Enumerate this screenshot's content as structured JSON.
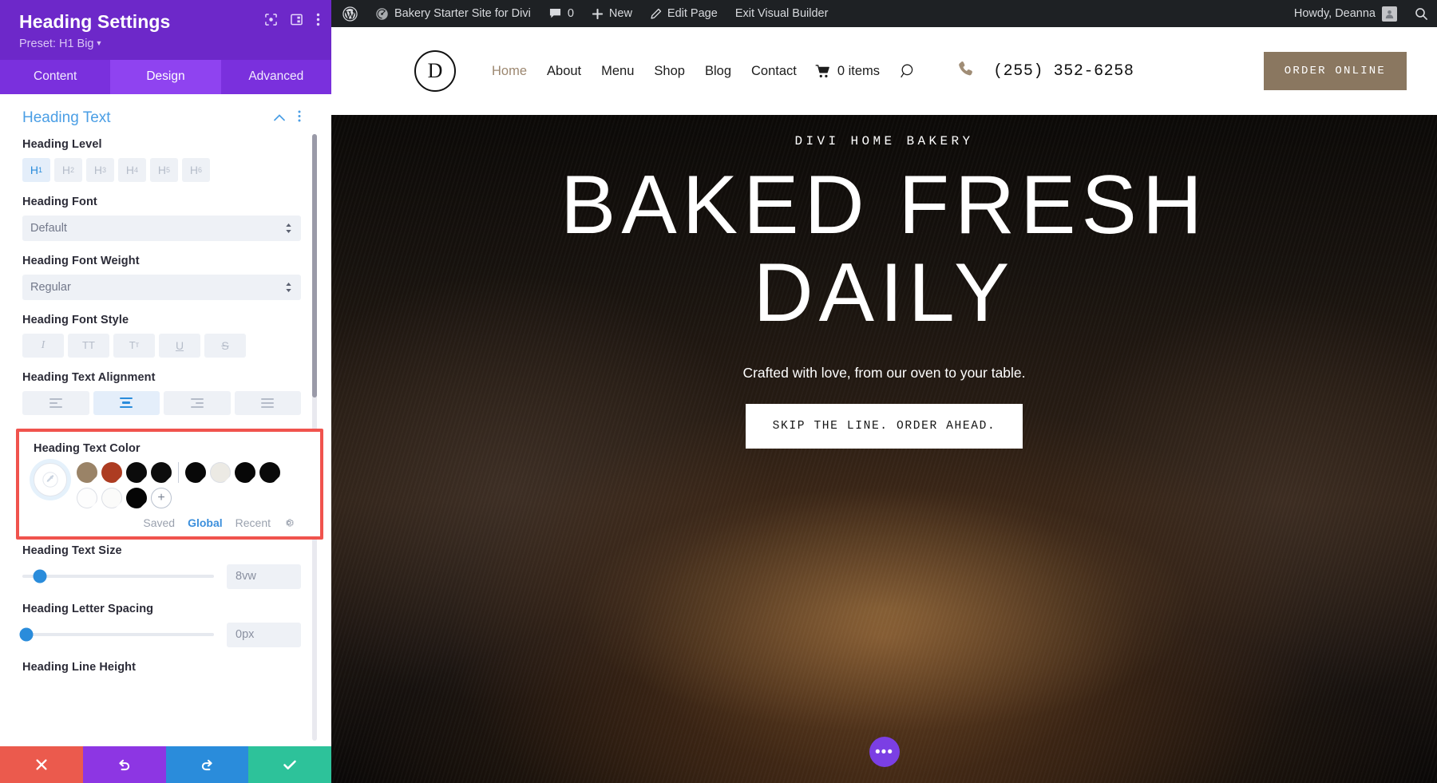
{
  "settings_panel": {
    "title": "Heading Settings",
    "preset_label": "Preset: H1 Big",
    "header_icons": [
      {
        "name": "focus-target-icon"
      },
      {
        "name": "layout-columns-icon"
      },
      {
        "name": "kebab-menu-icon"
      }
    ],
    "tabs": [
      {
        "label": "Content",
        "active": false
      },
      {
        "label": "Design",
        "active": true
      },
      {
        "label": "Advanced",
        "active": false
      }
    ],
    "section": {
      "title": "Heading Text",
      "collapse_icon": "chevron-up-icon",
      "menu_icon": "kebab-menu-icon"
    },
    "heading_level": {
      "label": "Heading Level",
      "options": [
        "H1",
        "H2",
        "H3",
        "H4",
        "H5",
        "H6"
      ],
      "selected": "H1"
    },
    "heading_font": {
      "label": "Heading Font",
      "value": "Default"
    },
    "heading_font_weight": {
      "label": "Heading Font Weight",
      "value": "Regular"
    },
    "heading_font_style": {
      "label": "Heading Font Style",
      "options": [
        "I",
        "TT",
        "Tт",
        "U",
        "S"
      ],
      "selected": null
    },
    "heading_text_alignment": {
      "label": "Heading Text Alignment",
      "options": [
        "left",
        "center",
        "right",
        "justify"
      ],
      "selected": "center"
    },
    "heading_text_color": {
      "label": "Heading Text Color",
      "eyedropper_icon": "eyedropper-icon",
      "swatches_row1": [
        "#9a8367",
        "#ad3c22",
        "#0b0b0b",
        "#0d0d0d",
        "#080808",
        "#eceae4",
        "#070707",
        "#0a0a0a"
      ],
      "swatches_row2": [
        "#fdfdfd",
        "#fbfbfa",
        "#050505"
      ],
      "add_label": "+",
      "tabs": [
        {
          "label": "Saved",
          "active": false
        },
        {
          "label": "Global",
          "active": true
        },
        {
          "label": "Recent",
          "active": false
        }
      ],
      "gear_icon": "gear-icon",
      "highlight_color": "#f0534d"
    },
    "heading_text_size": {
      "label": "Heading Text Size",
      "value": "8vw",
      "slider_pct": 9
    },
    "heading_letter_spacing": {
      "label": "Heading Letter Spacing",
      "value": "0px",
      "slider_pct": 2
    },
    "heading_line_height": {
      "label": "Heading Line Height"
    },
    "actions": [
      {
        "name": "cancel-button",
        "icon": "close-icon",
        "color": "#eb5a4d"
      },
      {
        "name": "undo-button",
        "icon": "undo-icon",
        "color": "#8d36e3"
      },
      {
        "name": "redo-button",
        "icon": "redo-icon",
        "color": "#2a8cdb"
      },
      {
        "name": "save-button",
        "icon": "check-icon",
        "color": "#2dc29a"
      }
    ]
  },
  "admin_bar": {
    "wp_logo": "wordpress-logo-icon",
    "site_name": "Bakery Starter Site for Divi",
    "comment_count": "0",
    "new_label": "New",
    "edit_page_label": "Edit Page",
    "exit_builder_label": "Exit Visual Builder",
    "howdy": "Howdy, Deanna",
    "search_icon": "search-icon"
  },
  "site_header": {
    "logo_letter": "D",
    "nav": [
      {
        "label": "Home",
        "current": true
      },
      {
        "label": "About",
        "current": false
      },
      {
        "label": "Menu",
        "current": false
      },
      {
        "label": "Shop",
        "current": false
      },
      {
        "label": "Blog",
        "current": false
      },
      {
        "label": "Contact",
        "current": false
      }
    ],
    "cart_label": "0 items",
    "phone": "(255) 352-6258",
    "order_button": "ORDER ONLINE"
  },
  "hero": {
    "eyebrow": "DIVI HOME BAKERY",
    "title_line1": "BAKED FRESH",
    "title_line2": "DAILY",
    "subtitle": "Crafted with love, from our oven to your table.",
    "cta": "SKIP THE LINE. ORDER AHEAD.",
    "fab_icon": "ellipsis-icon"
  }
}
